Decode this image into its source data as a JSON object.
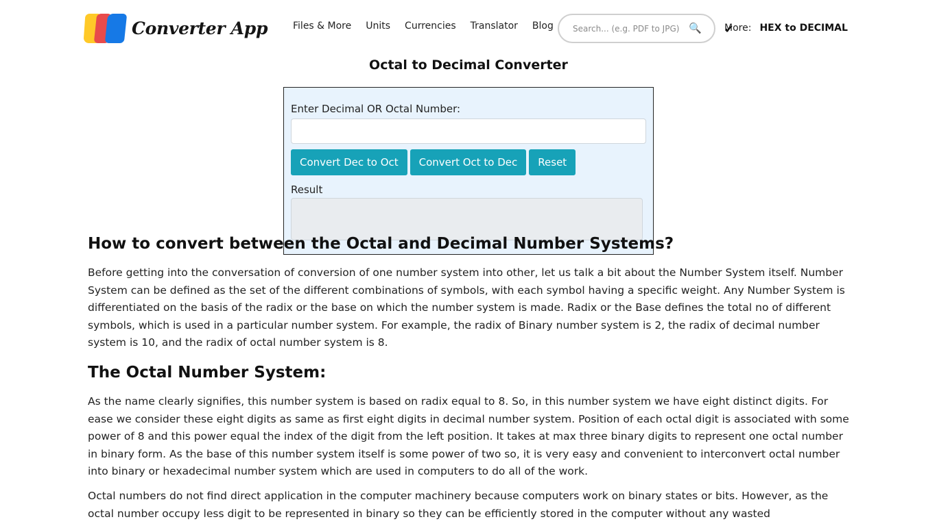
{
  "brand": {
    "name": "Converter App"
  },
  "nav": {
    "items": [
      {
        "label": "Files & More"
      },
      {
        "label": "Units"
      },
      {
        "label": "Currencies"
      },
      {
        "label": "Translator"
      },
      {
        "label": "Blog"
      }
    ]
  },
  "search": {
    "placeholder": "Search... (e.g. PDF to JPG)",
    "icon": "search-icon"
  },
  "more": {
    "label": "More:",
    "selected": "HEX to DECIMAL"
  },
  "page": {
    "title": "Octal to Decimal Converter"
  },
  "converter": {
    "input_label": "Enter Decimal OR Octal Number:",
    "input_value": "",
    "buttons": {
      "dec_to_oct": "Convert Dec to Oct",
      "oct_to_dec": "Convert Oct to Dec",
      "reset": "Reset"
    },
    "result_label": "Result",
    "result_value": ""
  },
  "article": {
    "heading1": "How to convert between the Octal and Decimal Number Systems?",
    "para1": "Before getting into the conversation of conversion of one number system into other, let us talk a bit about the Number System itself. Number System can be defined as the set of the different combinations of symbols, with each symbol having a specific weight. Any Number System is differentiated on the basis of the radix or the base on which the number system is made. Radix or the Base defines the total no of different symbols, which is used in a particular number system. For example, the radix of Binary number system is 2, the radix of decimal number system is 10, and the radix of octal number system is 8.",
    "heading2": "The Octal Number System:",
    "para2": "As the name clearly signifies, this number system is based on radix equal to 8. So, in this number system we have eight distinct digits. For ease we consider these eight digits as same as first eight digits in decimal number system. Position of each octal digit is associated with some power of 8 and this power equal the index of the digit from the left position. It takes at max three binary digits to represent one octal number in binary form. As the base of this number system itself is some power of two so, it is very easy and convenient to interconvert octal number into binary or hexadecimal number system which are used in computers to do all of the work.",
    "para3": "Octal numbers do not find direct application in the computer machinery because computers work on binary states or bits. However, as the octal number occupy less digit to be represented in binary so they can be efficiently stored in the computer without any wasted"
  }
}
